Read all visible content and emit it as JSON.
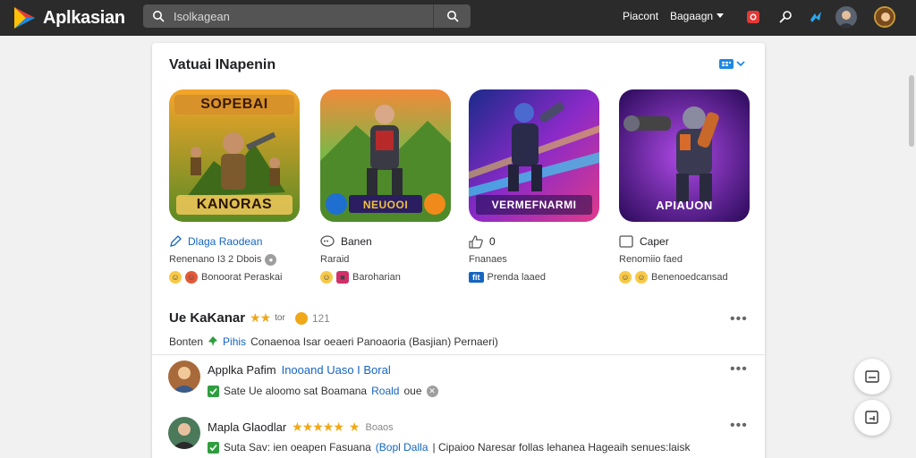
{
  "header": {
    "app_title": "Aplkasian",
    "search_value": "Isolkagean",
    "nav_link": "Piacont",
    "language_label": "Bagaagn",
    "icons": [
      "app-logo-icon",
      "search-icon",
      "notification-icon",
      "rocket-icon",
      "tweet-icon"
    ]
  },
  "section": {
    "title": "Vatuai INapenin",
    "toggle_label": "▤"
  },
  "apps": [
    {
      "tile_text": "SOPEBAI",
      "tile_caption": "KANORAS",
      "name": "Dlaga Raodean",
      "detail": "Renenano I3 2 Dbois",
      "detail_badge": "●",
      "tags": "Bonoorat Peraskai",
      "accent": "#e09a1c"
    },
    {
      "tile_text": "",
      "tile_caption": "NEUOOI",
      "name": "Banen",
      "detail": "Raraid",
      "detail_badge": "",
      "tags": "Baroharian",
      "accent": "#2fa84f"
    },
    {
      "tile_text": "",
      "tile_caption": "VERMEFNARMI",
      "name": "0",
      "detail": "Fnanaes",
      "detail_badge": "",
      "tags": "Prenda laaed",
      "tag_badge": "fit",
      "accent": "#7a2cd8"
    },
    {
      "tile_text": "",
      "tile_caption": "APIAUON",
      "name": "Caper",
      "detail": "Renomiio faed",
      "detail_badge": "",
      "tags": "Benenoedcansad",
      "accent": "#9a3ad6"
    }
  ],
  "rating": {
    "title": "Ue KaKanar",
    "stars": "★★",
    "star_label": "tor",
    "score": "121",
    "sub_prefix": "Bonten",
    "sub_highlight": "Pihis",
    "sub_rest": "Conaenoa Isar oeaeri Panoaoria (Basjian) Pernaeri)"
  },
  "reviews": [
    {
      "name": "Applka Pafim",
      "tag": "Inooand Uaso I Boral",
      "stars": "",
      "date": "",
      "text": "Sate Ue aloomo sat Boamana",
      "highlight": "Roald",
      "tail": "oue"
    },
    {
      "name": "Mapla Glaodlar",
      "tag": "",
      "stars": "★★★★★",
      "date": "Boaos",
      "text": "Suta Sav: ien oeapen  Fasuana",
      "highlight": "(Bopl Dalla",
      "tail": "| Cipaioo Naresar follas lehanea Hageaih senues:laisk"
    }
  ],
  "colors": {
    "topbar": "#2b2b2b",
    "accent_blue": "#1565c0",
    "check_green": "#2e9e3e",
    "star_gold": "#f0a818"
  }
}
